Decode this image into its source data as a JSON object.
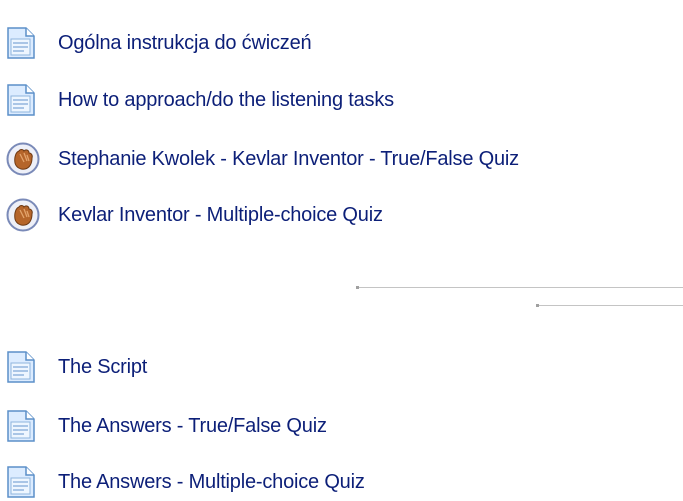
{
  "course_section_top": {
    "items": [
      {
        "label": "Ogólna instrukcja do ćwiczeń",
        "icon": "resource-page-icon"
      },
      {
        "label": "How to approach/do the listening tasks",
        "icon": "resource-page-icon"
      },
      {
        "label": "Stephanie Kwolek - Kevlar Inventor - True/False Quiz",
        "icon": "hot-potatoes-quiz-icon"
      },
      {
        "label": "Kevlar Inventor - Multiple-choice Quiz",
        "icon": "hot-potatoes-quiz-icon"
      }
    ]
  },
  "course_section_bottom": {
    "items": [
      {
        "label": "The Script",
        "icon": "resource-page-icon"
      },
      {
        "label": "The Answers - True/False Quiz",
        "icon": "resource-page-icon"
      },
      {
        "label": "The Answers - Multiple-choice Quiz",
        "icon": "resource-page-icon"
      }
    ]
  },
  "colors": {
    "link": "#0c1f78",
    "background": "#ffffff",
    "page_icon_fill": "#d9ecff",
    "page_icon_stroke": "#5b8fc9",
    "quiz_icon_hand": "#b5652a",
    "quiz_icon_ring": "#7a8ab8"
  }
}
